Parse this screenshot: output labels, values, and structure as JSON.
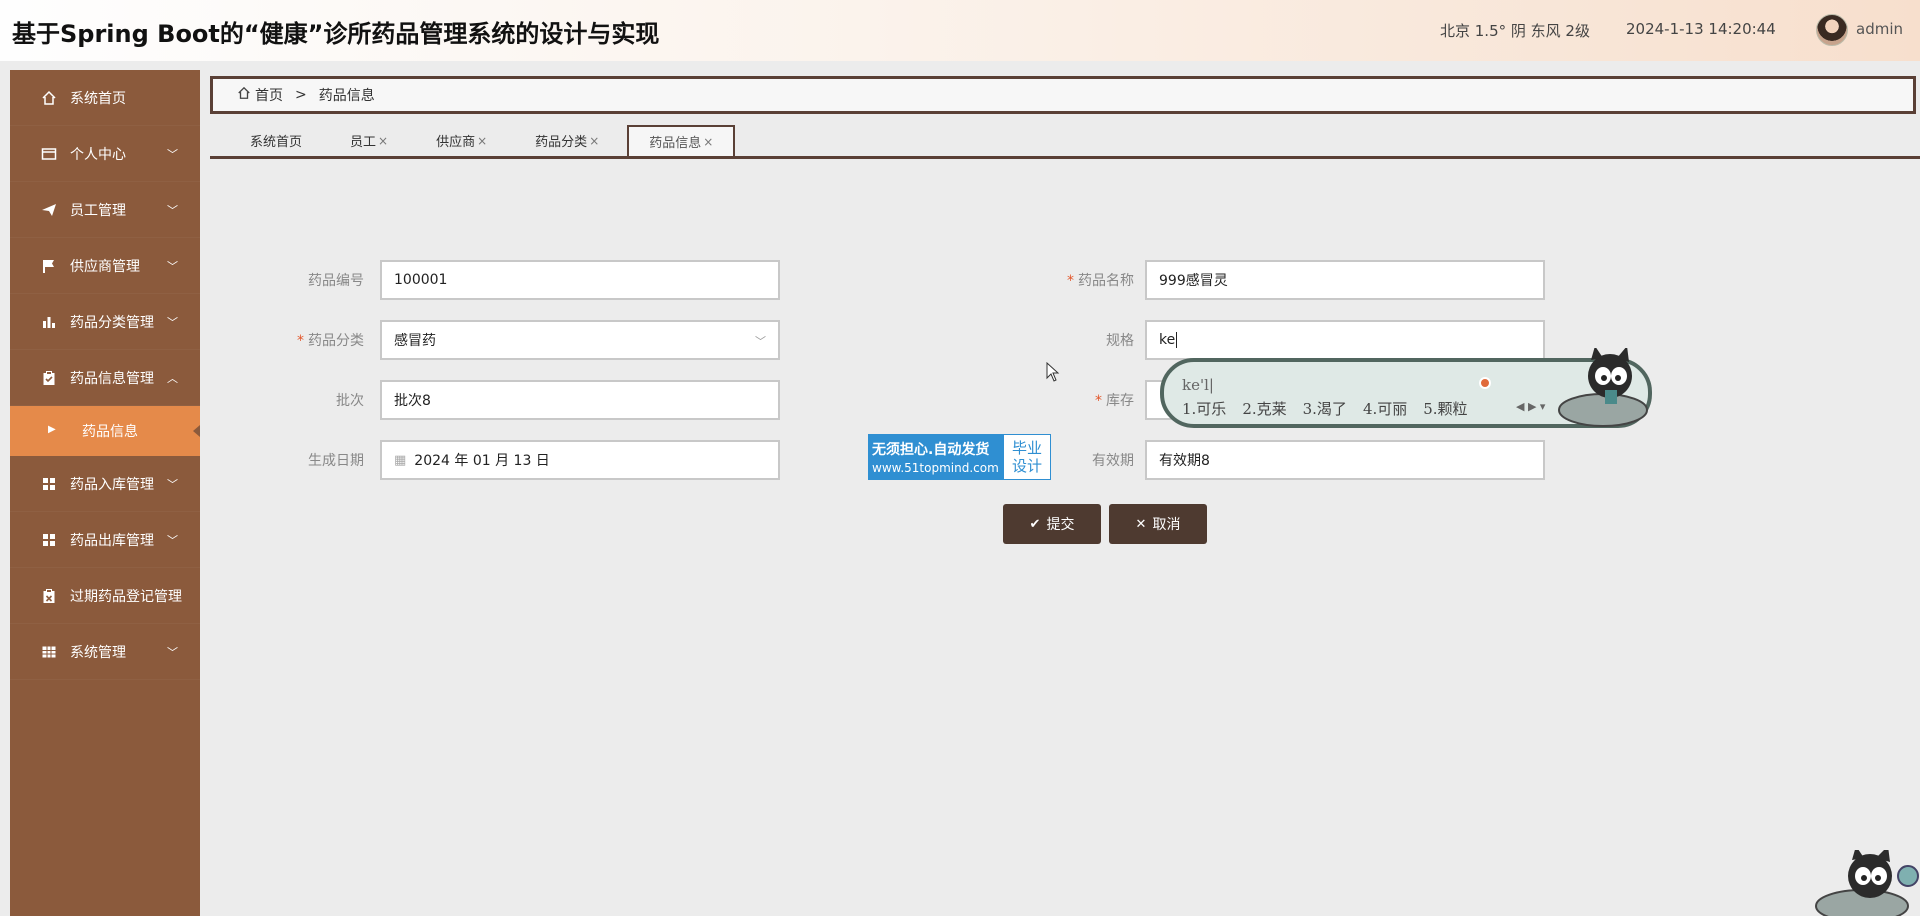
{
  "header": {
    "title": "基于Spring Boot的“健康”诊所药品管理系统的设计与实现",
    "weather": "北京  1.5°  阴  东风  2级",
    "datetime": "2024-1-13 14:20:44",
    "username": "admin"
  },
  "sidebar": {
    "items": [
      {
        "label": "系统首页",
        "icon": "home-icon"
      },
      {
        "label": "个人中心",
        "icon": "id-card-icon"
      },
      {
        "label": "员工管理",
        "icon": "paper-plane-icon"
      },
      {
        "label": "供应商管理",
        "icon": "flag-icon"
      },
      {
        "label": "药品分类管理",
        "icon": "bar-chart-icon"
      },
      {
        "label": "药品信息管理",
        "icon": "clipboard-icon"
      },
      {
        "label": "药品入库管理",
        "icon": "grid-icon"
      },
      {
        "label": "药品出库管理",
        "icon": "grid-icon"
      },
      {
        "label": "过期药品登记管理",
        "icon": "clipboard-icon"
      },
      {
        "label": "系统管理",
        "icon": "table-icon"
      }
    ],
    "active_sub": "药品信息"
  },
  "breadcrumb": {
    "home": "首页",
    "separator": ">",
    "current": "药品信息"
  },
  "tabs": [
    {
      "label": "系统首页"
    },
    {
      "label": "员工"
    },
    {
      "label": "供应商"
    },
    {
      "label": "药品分类"
    },
    {
      "label": "药品信息"
    }
  ],
  "tab_close": "×",
  "form": {
    "code_label": "药品编号",
    "code_value": "100001",
    "name_label": "药品名称",
    "name_value": "999感冒灵",
    "category_label": "药品分类",
    "category_value": "感冒药",
    "spec_label": "规格",
    "spec_value": "ke",
    "batch_label": "批次",
    "batch_value": "批次8",
    "stock_label": "库存",
    "date_label": "生成日期",
    "date_value": "2024 年 01 月 13 日",
    "expiry_label": "有效期",
    "expiry_value": "有效期8",
    "required_mark": "*"
  },
  "buttons": {
    "submit": "提交",
    "cancel": "取消"
  },
  "ad": {
    "line1": "无须担心.自动发货",
    "line2": "www.51topmind.com",
    "right1": "毕业",
    "right2": "设计"
  },
  "ime": {
    "composition": "ke'l|",
    "candidates": [
      "1.可乐",
      "2.克莱",
      "3.渴了",
      "4.可丽",
      "5.颗粒"
    ]
  }
}
